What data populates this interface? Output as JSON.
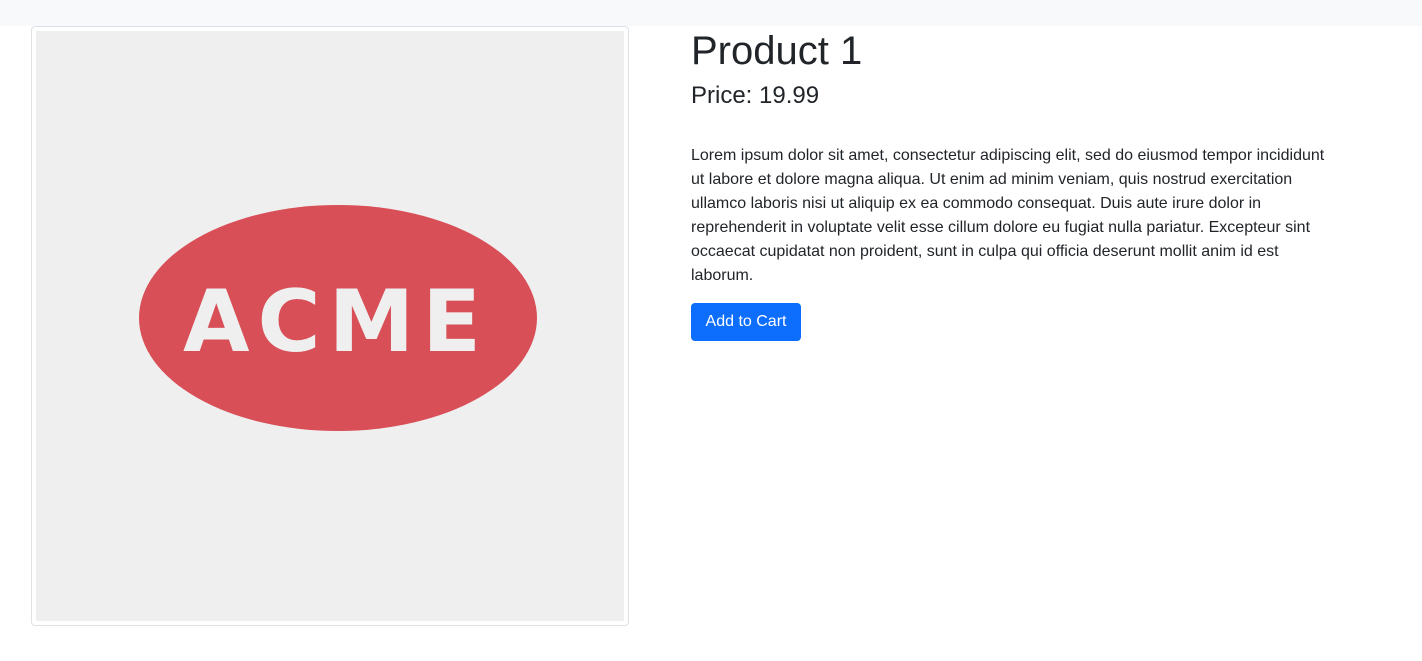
{
  "product": {
    "title": "Product 1",
    "price_label": "Price:",
    "price_value": "19.99",
    "description": "Lorem ipsum dolor sit amet, consectetur adipiscing elit, sed do eiusmod tempor incididunt ut labore et dolore magna aliqua. Ut enim ad minim veniam, quis nostrud exercitation ullamco laboris nisi ut aliquip ex ea commodo consequat. Duis aute irure dolor in reprehenderit in voluptate velit esse cillum dolore eu fugiat nulla pariatur. Excepteur sint occaecat cupidatat non proident, sunt in culpa qui officia deserunt mollit anim id est laborum.",
    "add_to_cart_label": "Add to Cart",
    "image": {
      "logo_text": "ACME",
      "logo_color": "#d94f58",
      "background_color": "#efefef"
    }
  },
  "colors": {
    "primary_button": "#0d6efd",
    "topbar": "#f8f9fa",
    "text": "#212529"
  }
}
